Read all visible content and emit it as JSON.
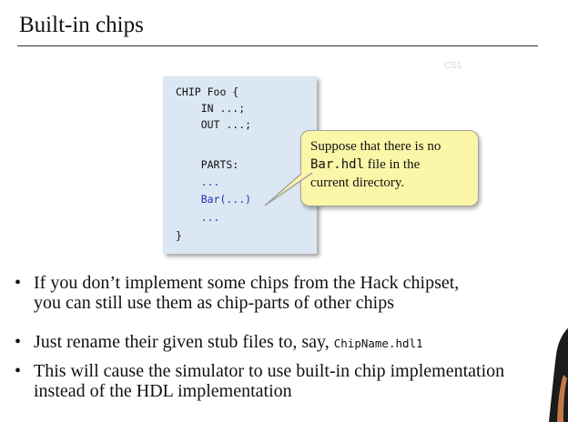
{
  "slide": {
    "title": "Built-in chips",
    "watermark": "CS1"
  },
  "code": [
    {
      "text": "CHIP Foo {",
      "color": "black"
    },
    {
      "text": "    IN ...;",
      "color": "black"
    },
    {
      "text": "    OUT ...;",
      "color": "black"
    },
    {
      "text": "",
      "color": "black"
    },
    {
      "text": "    PARTS:",
      "color": "black"
    },
    {
      "text": "    ...",
      "color": "blue"
    },
    {
      "text": "    Bar(...)",
      "color": "blue"
    },
    {
      "text": "    ...",
      "color": "blue"
    },
    {
      "text": "}",
      "color": "black"
    }
  ],
  "callout": {
    "line1": "Suppose that there is no",
    "line2_code": "Bar.hdl",
    "line2_rest": " file in the",
    "line3": "current directory."
  },
  "bullets": [
    {
      "marker": "•",
      "line1": "If you don’t implement some chips from the Hack chipset,",
      "line2": "you can still use them as chip-parts of other chips"
    },
    {
      "marker": "•",
      "line1": "Just rename their given stub files to, say, ",
      "code": "ChipName.hdl1"
    },
    {
      "marker": "•",
      "line1": "This will cause the simulator to use built-in chip implementation",
      "line2": "instead of the HDL implementation"
    }
  ],
  "colors": {
    "code_box_bg": "#dbe7f3",
    "callout_bg": "#fcf6a8",
    "code_blue": "#1f2fb5"
  }
}
